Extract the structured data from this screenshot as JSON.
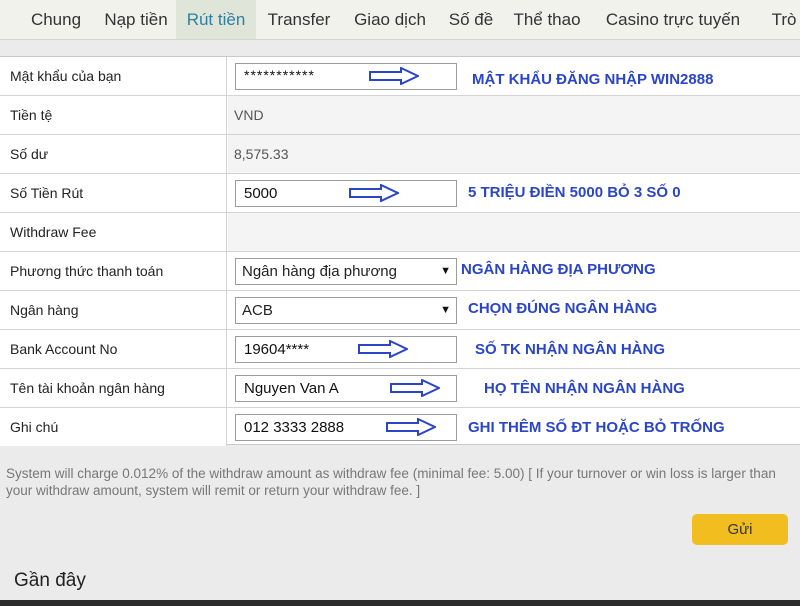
{
  "tabs": [
    {
      "label": "Chung",
      "active": false
    },
    {
      "label": "Nạp tiền",
      "active": false
    },
    {
      "label": "Rút tiền",
      "active": true
    },
    {
      "label": "Transfer",
      "active": false
    },
    {
      "label": "Giao dịch",
      "active": false
    },
    {
      "label": "Số đề",
      "active": false
    },
    {
      "label": "Thể thao",
      "active": false
    },
    {
      "label": "Casino trực tuyến",
      "active": false
    },
    {
      "label": "Trò",
      "active": false
    }
  ],
  "form": {
    "password": {
      "label": "Mật khẩu của bạn",
      "value": "***********",
      "note": "MẬT KHẨU ĐĂNG NHẬP WIN2888"
    },
    "currency": {
      "label": "Tiền tệ",
      "value": "VND"
    },
    "balance": {
      "label": "Số dư",
      "value": "8,575.33"
    },
    "amount": {
      "label": "Số Tiền Rút",
      "value": "5000",
      "note": "5 TRIỆU ĐIỀN 5000 BỎ 3 SỐ 0"
    },
    "fee": {
      "label": "Withdraw Fee"
    },
    "payment_method": {
      "label": "Phương thức thanh toán",
      "value": "Ngân hàng địa phương",
      "note": "NGÂN HÀNG ĐỊA PHƯƠNG"
    },
    "bank": {
      "label": "Ngân hàng",
      "value": "ACB",
      "note": "CHỌN ĐÚNG NGÂN HÀNG"
    },
    "account_no": {
      "label": "Bank Account No",
      "value": "19604****",
      "note": "SỐ TK NHẬN NGÂN HÀNG"
    },
    "account_name": {
      "label": "Tên tài khoản ngân hàng",
      "value": "Nguyen Van A",
      "note": "HỌ TÊN NHẬN NGÂN HÀNG"
    },
    "note": {
      "label": "Ghi chú",
      "value": "012 3333 2888",
      "note": "GHI THÊM SỐ ĐT  HOẶC BỎ TRỐNG"
    }
  },
  "info_text": "System will charge 0.012% of the withdraw amount as withdraw fee (minimal fee: 5.00) [ If your turnover or win loss is larger than your withdraw amount, system will remit or return your withdraw fee. ]",
  "submit_label": "Gửi",
  "recent_title": "Gần đây",
  "colors": {
    "accent": "#f2be1f",
    "annotation": "#2a45c8",
    "active_tab_text": "#2f7fa0"
  }
}
